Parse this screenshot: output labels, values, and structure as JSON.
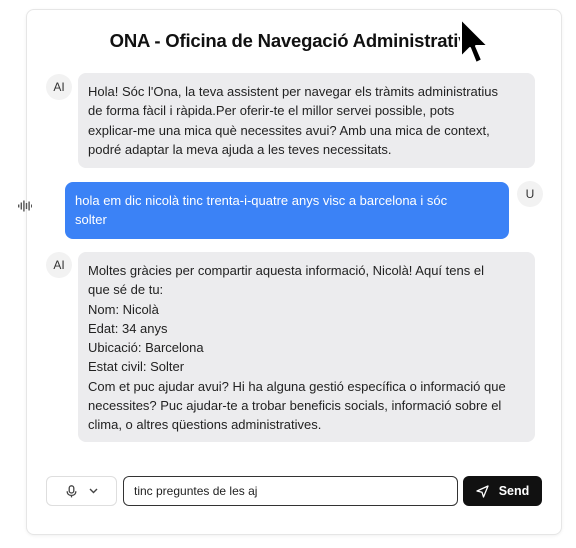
{
  "app": {
    "title": "ONA - Oficina de Navegació Administrativa"
  },
  "messages": [
    {
      "role": "ai",
      "avatar": "AI",
      "lines": [
        "Hola! Sóc l'Ona, la teva assistent per navegar els tràmits administratius",
        "de forma fàcil i ràpida.Per oferir-te el millor servei possible, pots",
        "explicar-me una mica què necessites avui? Amb una mica de context,",
        "podré adaptar la meva ajuda a les teves necessitats."
      ]
    },
    {
      "role": "user",
      "avatar": "U",
      "lines": [
        "hola em dic nicolà tinc trenta-i-quatre anys visc a barcelona i sóc",
        "solter"
      ]
    },
    {
      "role": "ai",
      "avatar": "AI",
      "lines": [
        "Moltes gràcies per compartir aquesta informació, Nicolà! Aquí tens el",
        "que sé de tu:",
        "Nom: Nicolà",
        "Edat: 34 anys",
        "Ubicació: Barcelona",
        "Estat civil: Solter",
        "Com et puc ajudar avui? Hi ha alguna gestió específica o informació que",
        "necessites? Puc ajudar-te a trobar beneficis socials, informació sobre el",
        "clima, o altres qüestions administratives."
      ]
    }
  ],
  "composer": {
    "input_value": "tinc preguntes de les aj",
    "send_label": "Send",
    "mic_icon": "microphone-icon",
    "dropdown_icon": "chevron-down-icon",
    "send_icon": "send-arrow-icon"
  },
  "colors": {
    "user_bubble": "#3b82f6",
    "ai_bubble": "#ececee",
    "send_button": "#111111"
  }
}
